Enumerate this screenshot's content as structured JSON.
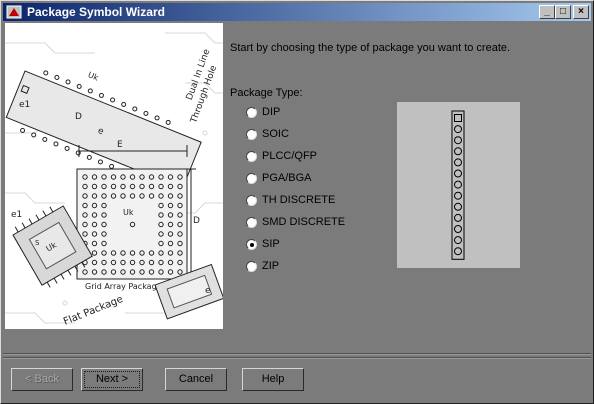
{
  "window": {
    "title": "Package Symbol Wizard",
    "controls": {
      "minimize": "_",
      "maximize": "□",
      "close": "×"
    }
  },
  "intro_text": "Start by choosing the type of package you want to create.",
  "package_type_label": "Package Type:",
  "package_types": [
    {
      "label": "DIP",
      "selected": false
    },
    {
      "label": "SOIC",
      "selected": false
    },
    {
      "label": "PLCC/QFP",
      "selected": false
    },
    {
      "label": "PGA/BGA",
      "selected": false
    },
    {
      "label": "TH DISCRETE",
      "selected": false
    },
    {
      "label": "SMD DISCRETE",
      "selected": false
    },
    {
      "label": "SIP",
      "selected": true
    },
    {
      "label": "ZIP",
      "selected": false
    }
  ],
  "illustration": {
    "labels": [
      "Uk",
      "E",
      "Dual In Line",
      "Through Hole",
      "e1",
      "e",
      "D",
      "Uk",
      "Grid Array Package",
      "Flat Package",
      "Uk",
      "e1",
      "S",
      "D",
      "e"
    ]
  },
  "preview": {
    "pin_count": 13
  },
  "buttons": {
    "back": "< Back",
    "next": "Next >",
    "cancel": "Cancel",
    "help": "Help"
  },
  "colors": {
    "dialog_bg": "#7b7b7b",
    "titlebar_start": "#0a246a",
    "titlebar_end": "#a6caf0",
    "preview_bg": "#c0c0c0"
  }
}
